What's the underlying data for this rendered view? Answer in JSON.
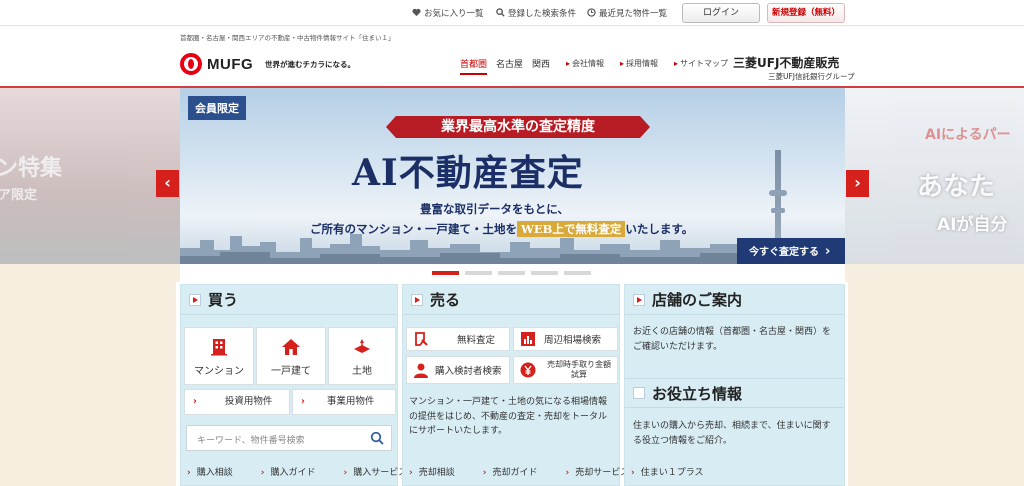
{
  "topbar": {
    "favorites": "お気に入り一覧",
    "saved_search": "登録した検索条件",
    "recent": "最近見た物件一覧",
    "login": "ログイン",
    "register": "新規登録（無料）"
  },
  "header": {
    "tagline": "首都圏・名古屋・関西エリアの不動産・中古物件情報サイト「住まい１」",
    "logo": "MUFG",
    "slogan": "世界が進むチカラになる。",
    "area_tabs": [
      {
        "label": "首都圏",
        "active": true
      },
      {
        "label": "名古屋",
        "active": false
      },
      {
        "label": "関西",
        "active": false
      }
    ],
    "sub_links": [
      "会社情報",
      "採用情報",
      "サイトマップ"
    ],
    "company": "三菱UFJ不動産販売",
    "company_sub": "三菱UFJ信託銀行グループ"
  },
  "carousel": {
    "left_peek_1": "ン特集",
    "left_peek_2": "ア限定",
    "right_peek_1": "AIによるパー",
    "right_peek_2": "あなた",
    "right_peek_3": "AIが自分",
    "members_badge": "会員限定",
    "kicker": "業界最高水準の査定精度",
    "headline": "AI不動産査定",
    "body_line1": "豊富な取引データをもとに、",
    "body_line2_pre": "ご所有のマンション・一戸建て・土地を",
    "body_line2_hl": "WEB上で無料査定",
    "body_line2_post": "いたします。",
    "cta": "今すぐ査定する",
    "prev_arrow": "‹",
    "next_arrow": "›",
    "active_dot": 0,
    "dot_count": 5
  },
  "buy": {
    "title": "買う",
    "tiles": [
      {
        "label": "マンション",
        "icon": "building-icon"
      },
      {
        "label": "一戸建て",
        "icon": "house-icon"
      },
      {
        "label": "土地",
        "icon": "land-icon"
      }
    ],
    "row_buttons": [
      "投資用物件",
      "事業用物件"
    ],
    "search_placeholder": "キーワード、物件番号検索",
    "links": [
      "購入相談",
      "購入ガイド",
      "購入サービス"
    ]
  },
  "sell": {
    "title": "売る",
    "buttons": [
      {
        "label": "無料査定",
        "icon": "assessment-icon"
      },
      {
        "label": "周辺相場検索",
        "icon": "chart-icon"
      },
      {
        "label": "購入検討者検索",
        "icon": "person-icon"
      },
      {
        "label": "売却時手取り金額試算",
        "icon": "yen-icon"
      }
    ],
    "desc": [
      "マンション・一戸建て・土地の気になる相場情報",
      "の提供をはじめ、不動産の査定・売却をトータル",
      "にサポートいたします。"
    ],
    "links": [
      "売却相談",
      "売却ガイド",
      "売却サービス"
    ]
  },
  "info": {
    "store_title": "店舗のご案内",
    "store_desc": [
      "お近くの店舗の情報（首都圏・名古屋・関西）を",
      "ご確認いただけます。"
    ],
    "useful_title": "お役立ち情報",
    "useful_desc": [
      "住まいの購入から売却、相続まで、住まいに関す",
      "る役立つ情報をご紹介。"
    ],
    "useful_link": "住まい１プラス"
  },
  "colors": {
    "accent": "#d6201c",
    "navy": "#1b2f66",
    "card_bg": "#d8ecf3",
    "page_bg": "#f6efe0"
  }
}
